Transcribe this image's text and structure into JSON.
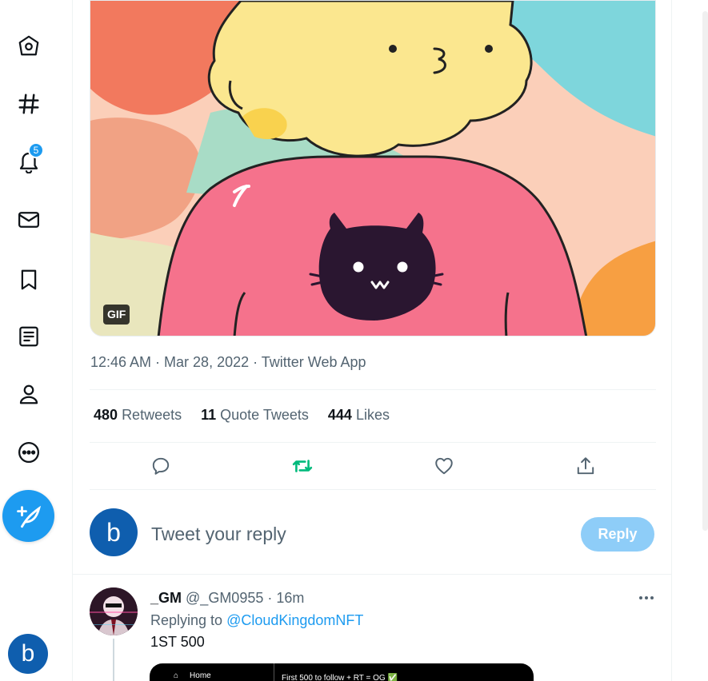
{
  "nav": {
    "items": [
      {
        "icon": "home-icon"
      },
      {
        "icon": "explore-hashtag-icon"
      },
      {
        "icon": "notifications-bell-icon",
        "badge": "5"
      },
      {
        "icon": "messages-envelope-icon"
      },
      {
        "icon": "bookmarks-icon"
      },
      {
        "icon": "lists-icon"
      },
      {
        "icon": "profile-icon"
      },
      {
        "icon": "more-icon"
      }
    ],
    "compose_icon": "compose-feather-icon",
    "avatar_letter": "b"
  },
  "tweet": {
    "media_badge": "GIF",
    "meta": "12:46 AM · Mar 28, 2022 · Twitter Web App",
    "stats": {
      "retweets_count": "480",
      "retweets_label": "Retweets",
      "quotes_count": "11",
      "quotes_label": "Quote Tweets",
      "likes_count": "444",
      "likes_label": "Likes"
    },
    "actions": [
      "reply-icon",
      "retweet-icon",
      "like-heart-icon",
      "share-icon"
    ],
    "retweet_active_color": "#00ba7c"
  },
  "reply_box": {
    "avatar_letter": "b",
    "placeholder": "Tweet your reply",
    "button_label": "Reply"
  },
  "reply_tweet": {
    "name": "_GM",
    "handle": "@_GM0955",
    "time": "· 16m",
    "replying_prefix": "Replying to",
    "replying_to": "@CloudKingdomNFT",
    "text": "1ST 500",
    "image": {
      "home_label": "Home",
      "title": "First 500 to follow + RT = OG ✅"
    }
  },
  "colors": {
    "accent": "#1d9bf0",
    "sweater": "#f5728c",
    "hair": "#fbe78f",
    "cat": "#2a1630"
  }
}
